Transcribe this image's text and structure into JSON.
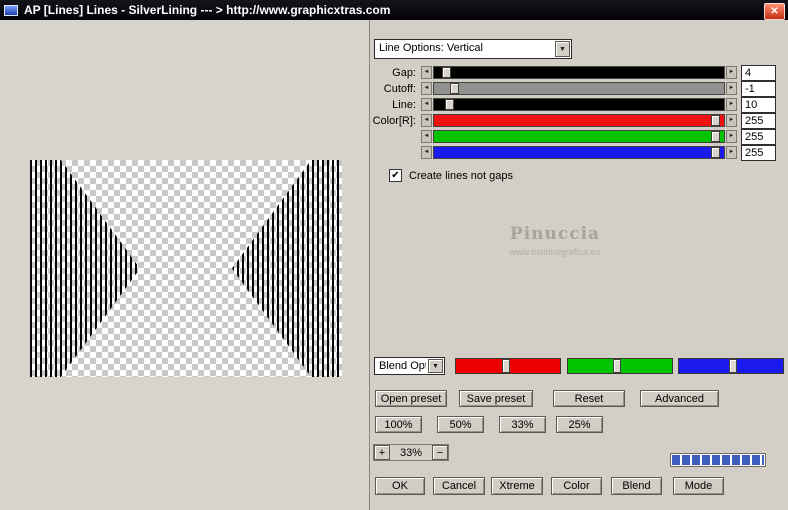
{
  "title_bar": {
    "title": "AP [Lines]  Lines - SilverLining   --- > http://www.graphicxtras.com"
  },
  "icons": {
    "close": "✕",
    "dropdown_arrow": "▼",
    "check": "✔",
    "arrow_left": "◄",
    "arrow_right": "►"
  },
  "line_options_dropdown": {
    "selected": "Line Options: Vertical"
  },
  "sliders": [
    {
      "label": "Gap:",
      "value": "4",
      "track_color": "#000000",
      "thumb_pct": 4
    },
    {
      "label": "Cutoff:",
      "value": "-1",
      "track_color": "#919191",
      "thumb_pct": 7
    },
    {
      "label": "Line:",
      "value": "10",
      "track_color": "#000000",
      "thumb_pct": 5
    },
    {
      "label": "Color[R]:",
      "value": "255",
      "track_color": "#ee1111",
      "thumb_pct": 97
    },
    {
      "label": "",
      "value": "255",
      "track_color": "#00c400",
      "thumb_pct": 97
    },
    {
      "label": "",
      "value": "255",
      "track_color": "#1a1aee",
      "thumb_pct": 97
    }
  ],
  "create_lines_checkbox": {
    "label": "Create lines not gaps",
    "checked": true
  },
  "watermark": {
    "name": "Pinuccia",
    "url": "www.maidiregrafica.eu"
  },
  "blend": {
    "dropdown_label": "Blend Opti",
    "channels": [
      {
        "name": "red",
        "color": "#ee0000",
        "thumb_pct": 48
      },
      {
        "name": "green",
        "color": "#00c400",
        "thumb_pct": 47
      },
      {
        "name": "blue",
        "color": "#1a1aee",
        "thumb_pct": 52
      }
    ]
  },
  "preset_buttons": {
    "open": "Open preset",
    "save": "Save preset",
    "reset": "Reset",
    "advanced": "Advanced"
  },
  "zoom_buttons": {
    "b100": "100%",
    "b50": "50%",
    "b33": "33%",
    "b25": "25%"
  },
  "zoom_stepper": {
    "plus": "+",
    "value": "33%",
    "minus": "−"
  },
  "action_buttons": {
    "ok": "OK",
    "cancel": "Cancel",
    "xtreme": "Xtreme",
    "color": "Color",
    "blend": "Blend",
    "mode": "Mode"
  }
}
